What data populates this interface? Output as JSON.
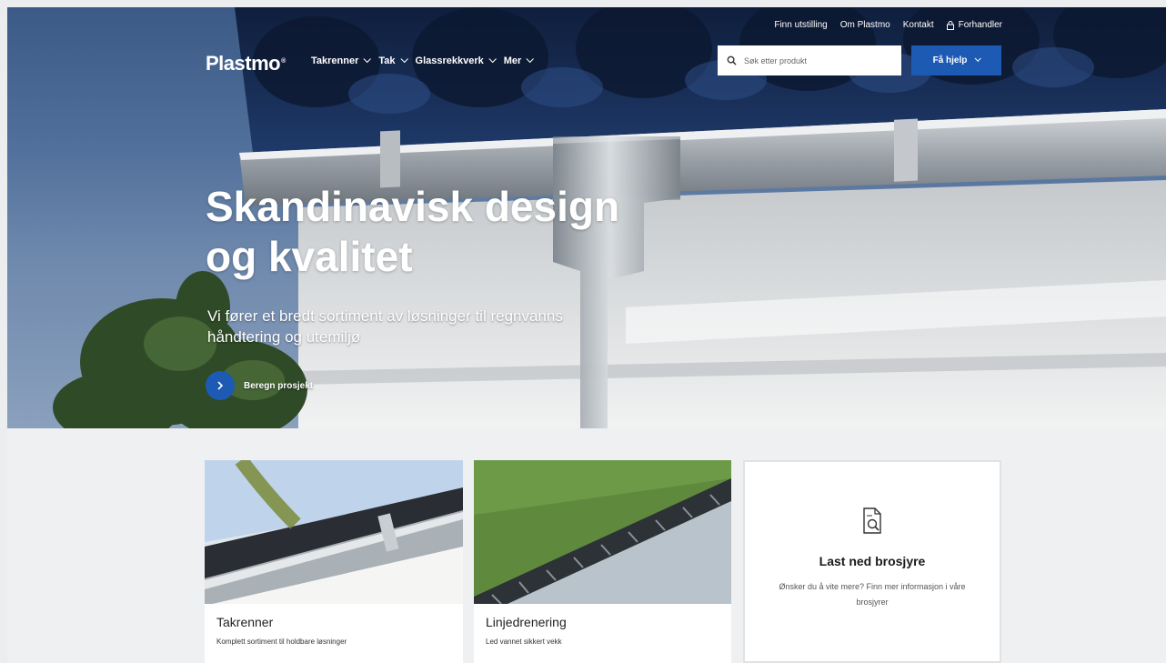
{
  "header": {
    "logo_text": "Plastmo",
    "utility_links": [
      "Finn utstilling",
      "Om Plastmo",
      "Kontakt",
      "Forhandler"
    ],
    "nav_items": [
      "Takrenner",
      "Tak",
      "Glassrekkverk",
      "Mer"
    ],
    "search_placeholder": "Søk etter produkt",
    "help_label": "Få hjelp"
  },
  "hero": {
    "title_line1": "Skandinavisk design",
    "title_line2": "og kvalitet",
    "subtitle_line1": "Vi fører et bredt sortiment av løsninger til regnvanns",
    "subtitle_line2": "håndtering og utemiljø",
    "cta_label": "Beregn prosjekt"
  },
  "cards": [
    {
      "title": "Takrenner",
      "description": "Komplett sortiment til holdbare løsninger"
    },
    {
      "title": "Linjedrenering",
      "description": "Led vannet sikkert vekk"
    },
    {
      "title": "Last ned brosjyre",
      "description": "Ønsker du å vite mere? Finn mer informasjon i våre brosjyrer"
    }
  ],
  "colors": {
    "accent": "#1d5ab4",
    "page_background": "#eef0f1"
  },
  "icons": [
    "search-icon",
    "chevron-down-icon",
    "lock-icon",
    "arrow-right-icon",
    "brochure-icon"
  ]
}
